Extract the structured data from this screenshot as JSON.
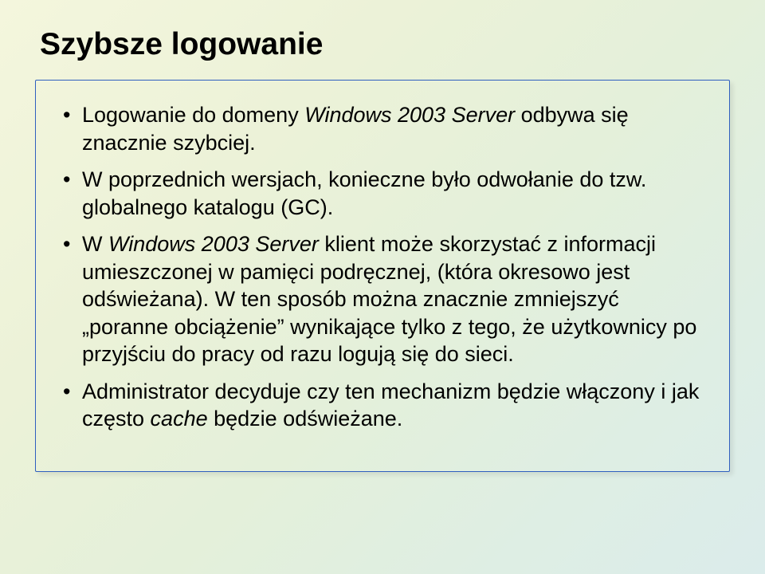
{
  "title": "Szybsze logowanie",
  "bullets": [
    {
      "prefix": "Logowanie do domeny ",
      "italic": "Windows 2003 Server",
      "suffix": " odbywa się znacznie szybciej."
    },
    {
      "prefix": "W poprzednich wersjach, konieczne było odwołanie do tzw. globalnego katalogu (GC).",
      "italic": "",
      "suffix": ""
    },
    {
      "prefix": "W ",
      "italic": "Windows 2003 Server",
      "suffix": " klient może skorzystać z informacji umieszczonej w pamięci podręcznej, (która okresowo jest odświeżana). W ten sposób można znacznie zmniejszyć „poranne obciążenie” wynikające tylko z tego, że użytkownicy po przyjściu do pracy od razu logują się do sieci."
    },
    {
      "prefix": "Administrator decyduje czy ten mechanizm będzie włączony i jak często ",
      "italic": "cache",
      "suffix": " będzie odświeżane."
    }
  ]
}
